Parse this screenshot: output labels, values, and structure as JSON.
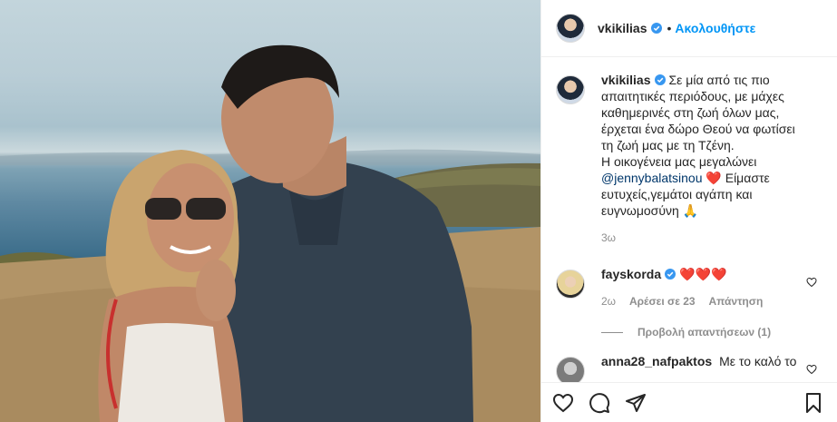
{
  "header": {
    "username": "vkikilias",
    "dot": "•",
    "follow_label": "Ακολουθήστε"
  },
  "caption": {
    "username": "vkikilias",
    "lines": [
      "Σε μία από τις πιο",
      "απαιτητικές περιόδους, με μάχες",
      "καθημερινές στη ζωή όλων μας,",
      "έρχεται ένα δώρο Θεού να φωτίσει",
      "τη ζωή μας με τη Τζένη.",
      "Η οικογένεια μας μεγαλώνει"
    ],
    "mention": "@jennybalatsinou",
    "heart": "❤️",
    "after_mention": " Είμαστε",
    "tail_lines": [
      "ευτυχείς,γεμάτοι αγάπη και",
      "ευγνωμοσύνη 🙏"
    ],
    "time": "3ω"
  },
  "comments": [
    {
      "username": "fayskorda",
      "text": "❤️❤️❤️",
      "time": "2ω",
      "likes": "Αρέσει σε 23",
      "reply": "Απάντηση",
      "view_replies": "Προβολή απαντήσεων (1)"
    },
    {
      "username": "anna28_nafpaktos",
      "text": "Με το καλό το"
    }
  ],
  "colors": {
    "accent": "#0095f6",
    "verified": "#3897f0",
    "heart": "#ed4956",
    "muted": "#8e8e8e"
  },
  "icons": {
    "like": "heart-outline-icon",
    "comment": "speech-bubble-icon",
    "share": "paper-plane-icon",
    "save": "bookmark-icon"
  }
}
